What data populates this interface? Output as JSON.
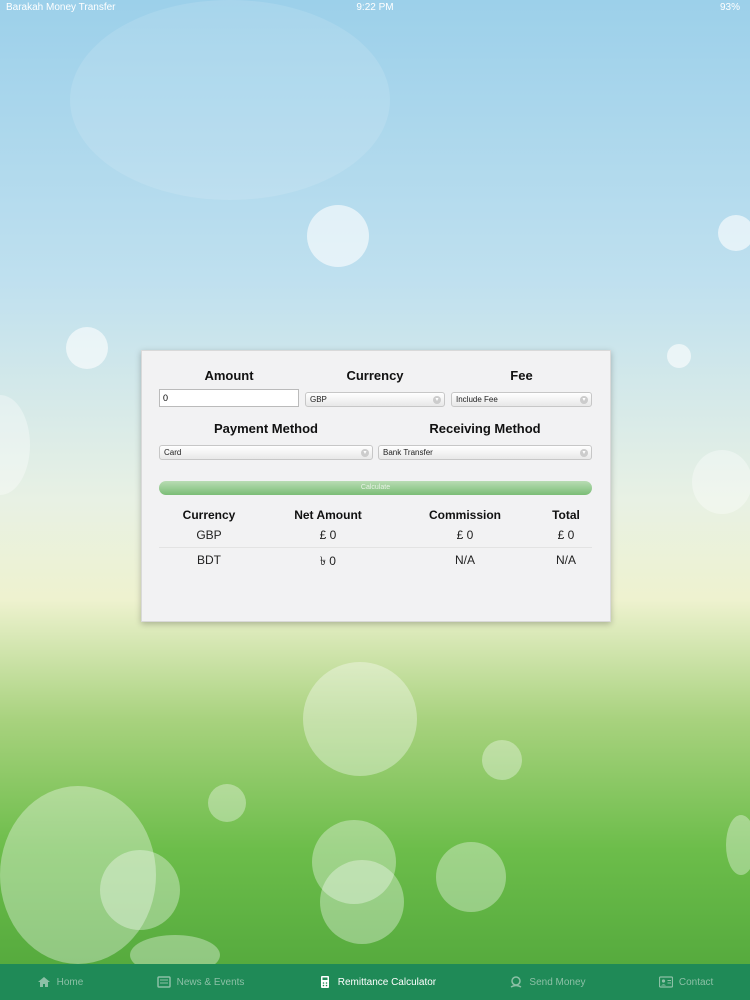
{
  "status_bar": {
    "carrier": "Barakah Money Transfer",
    "time": "9:22 PM",
    "battery": "93%"
  },
  "calculator": {
    "amount_label": "Amount",
    "currency_label": "Currency",
    "fee_label": "Fee",
    "amount_value": "0",
    "currency_value": "GBP",
    "fee_value": "Include Fee",
    "payment_method_label": "Payment Method",
    "receiving_method_label": "Receiving Method",
    "payment_method_value": "Card",
    "receiving_method_value": "Bank Transfer",
    "calculate_label": "Calculate"
  },
  "results": {
    "headers": [
      "Currency",
      "Net Amount",
      "Commission",
      "Total"
    ],
    "rows": [
      [
        "GBP",
        "£ 0",
        "£ 0",
        "£ 0"
      ],
      [
        "BDT",
        "৳ 0",
        "N/A",
        "N/A"
      ]
    ]
  },
  "tab_bar": {
    "items": [
      {
        "label": "Home",
        "icon": "home-icon",
        "active": false
      },
      {
        "label": "News & Events",
        "icon": "news-icon",
        "active": false
      },
      {
        "label": "Remittance Calculator",
        "icon": "calculator-icon",
        "active": true
      },
      {
        "label": "Send Money",
        "icon": "send-money-icon",
        "active": false
      },
      {
        "label": "Contact",
        "icon": "contact-icon",
        "active": false
      }
    ]
  }
}
